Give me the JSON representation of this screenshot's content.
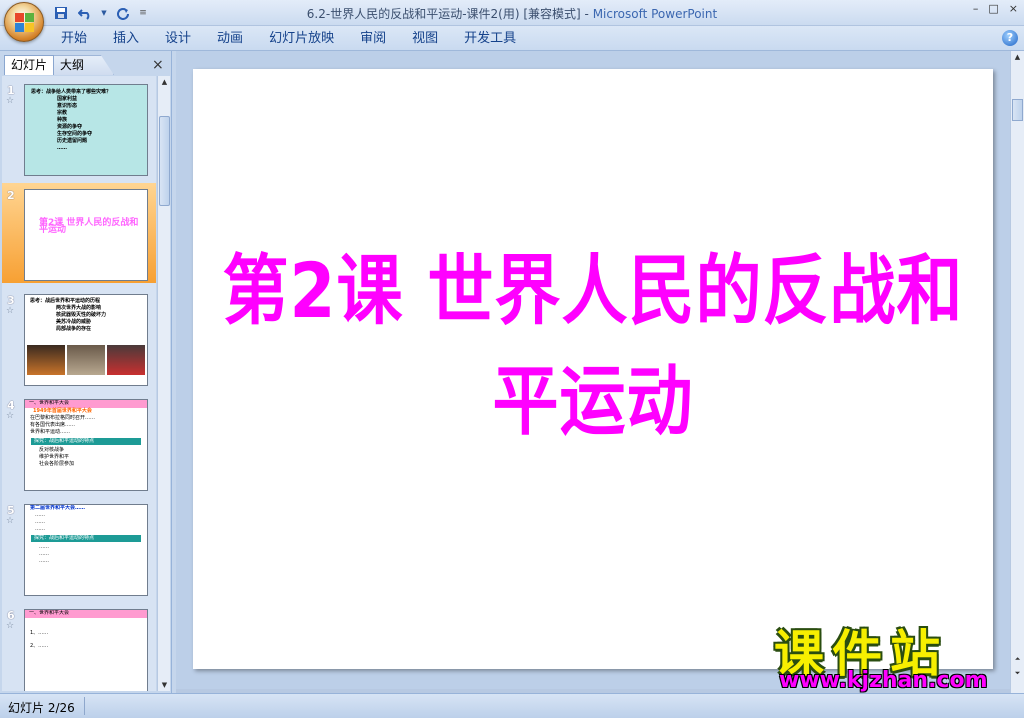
{
  "window": {
    "title": "6.2-世界人民的反战和平运动-课件2(用) [兼容模式] - ",
    "app_name": "Microsoft PowerPoint",
    "controls": [
      "–",
      "□",
      "×"
    ]
  },
  "ribbon": {
    "tabs": [
      "开始",
      "插入",
      "设计",
      "动画",
      "幻灯片放映",
      "审阅",
      "视图",
      "开发工具"
    ],
    "help": "?"
  },
  "left_pane": {
    "tabs": [
      "幻灯片",
      "大纲"
    ],
    "close": "×",
    "slides": [
      {
        "num": "1",
        "heading": "思考：战争给人类带来了哪些灾难？",
        "lines": [
          "国家利益",
          "意识形态",
          "宗教",
          "种族",
          "资源的争夺",
          "生存空间的争夺",
          "历史遗留问题",
          "……"
        ]
      },
      {
        "num": "2",
        "title": "第2课  世界人民的反战和平运动"
      },
      {
        "num": "3",
        "heading": "思考：战后世界和平运动的历程",
        "lines": [
          "两次世界大战的影响",
          "核武器毁灭性的破坏力",
          "美苏冷战的威胁",
          "局部战争的存在"
        ]
      },
      {
        "num": "4",
        "band": "一、世界和平大会",
        "sub": "1949年首届世界和平大会",
        "lines": [
          "在巴黎和布拉格同时召开……",
          "有各国代表出席……",
          "世界和平运动……"
        ],
        "teal": "探究：战后和平运动的特点",
        "bottom": [
          "反对核战争",
          "维护世界和平",
          "社会各阶层参加"
        ]
      },
      {
        "num": "5",
        "heading": "第二届世界和平大会……",
        "lines": [
          "……",
          "……",
          "……"
        ],
        "teal": "探究：战后和平运动的特点",
        "bottom": [
          "……",
          "……",
          "……"
        ]
      },
      {
        "num": "6",
        "band": "一、世界和平大会",
        "lines": [
          "1、……",
          "2、……"
        ]
      }
    ]
  },
  "slide": {
    "title": "第2课  世界人民的反战和平运动"
  },
  "status": {
    "slide_indicator": "幻灯片 2/26"
  },
  "watermark": {
    "title": "课件站",
    "url": "www.kjzhan.com"
  },
  "colors": {
    "title_magenta": "#ff00ff",
    "selected_thumb": "#f7a033",
    "ribbon_blue": "#15428b"
  }
}
